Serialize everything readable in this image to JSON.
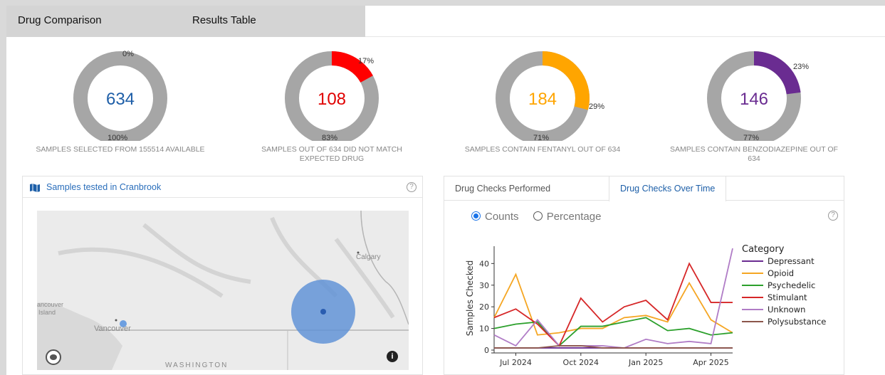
{
  "tabs": [
    {
      "label": "Drug Comparison"
    },
    {
      "label": "Results Table"
    }
  ],
  "donuts": [
    {
      "value": "634",
      "slice_percent": 0,
      "slice_label": "0%",
      "rest_label": "100%",
      "color": "#1f5fa8",
      "caption": "SAMPLES SELECTED FROM 155514 AVAILABLE"
    },
    {
      "value": "108",
      "slice_percent": 17,
      "slice_label": "17%",
      "rest_label": "83%",
      "color": "#ff0000",
      "caption": "SAMPLES OUT OF 634 DID NOT MATCH EXPECTED DRUG"
    },
    {
      "value": "184",
      "slice_percent": 29,
      "slice_label": "29%",
      "rest_label": "71%",
      "color": "#ffa500",
      "caption": "SAMPLES CONTAIN FENTANYL OUT OF 634"
    },
    {
      "value": "146",
      "slice_percent": 23,
      "slice_label": "23%",
      "rest_label": "77%",
      "color": "#6a2c91",
      "caption": "SAMPLES CONTAIN BENZODIAZEPINE OUT OF 634"
    }
  ],
  "map_panel": {
    "title": "Samples tested in Cranbrook",
    "help": "?",
    "labels": {
      "calgary": "Calgary",
      "vancouver": "Vancouver",
      "vancouver_island_1": "ancouver",
      "vancouver_island_2": "Island",
      "washington": "WASHINGTON"
    },
    "info": "i"
  },
  "chart_panel": {
    "tabs": [
      {
        "label": "Drug Checks Performed",
        "active": false
      },
      {
        "label": "Drug Checks Over Time",
        "active": true
      }
    ],
    "radio": {
      "counts": "Counts",
      "percentage": "Percentage",
      "selected": "counts"
    },
    "help": "?"
  },
  "chart_data": {
    "type": "line",
    "ylabel": "Samples Checked",
    "xlabel": "",
    "ylim": [
      0,
      48
    ],
    "yticks": [
      0,
      10,
      20,
      30,
      40
    ],
    "x": [
      "2024-06",
      "2024-07",
      "2024-08",
      "2024-09",
      "2024-10",
      "2024-11",
      "2024-12",
      "2025-01",
      "2025-02",
      "2025-03",
      "2025-04",
      "2025-05"
    ],
    "xticks": [
      {
        "label": "Jul 2024",
        "at": "2024-07"
      },
      {
        "label": "Oct 2024",
        "at": "2024-10"
      },
      {
        "label": "Jan 2025",
        "at": "2025-01"
      },
      {
        "label": "Apr 2025",
        "at": "2025-04"
      }
    ],
    "legend_title": "Category",
    "legend_position": "right",
    "series": [
      {
        "name": "Depressant",
        "color": "#6a2c91",
        "values": [
          1,
          1,
          1,
          1,
          1,
          1,
          1,
          1,
          1,
          1,
          1,
          1
        ]
      },
      {
        "name": "Opioid",
        "color": "#f5a623",
        "values": [
          15,
          35,
          7,
          8,
          10,
          10,
          15,
          16,
          13,
          31,
          14,
          8
        ]
      },
      {
        "name": "Psychedelic",
        "color": "#2ca02c",
        "values": [
          10,
          12,
          13,
          2,
          11,
          11,
          13,
          15,
          9,
          10,
          7,
          8
        ]
      },
      {
        "name": "Stimulant",
        "color": "#d62728",
        "values": [
          15,
          19,
          12,
          2,
          24,
          13,
          20,
          23,
          14,
          40,
          22,
          22
        ]
      },
      {
        "name": "Unknown",
        "color": "#b07cc6",
        "values": [
          7,
          2,
          14,
          2,
          2,
          2,
          1,
          5,
          3,
          4,
          3,
          47
        ]
      },
      {
        "name": "Polysubstance",
        "color": "#8c564b",
        "values": [
          1,
          1,
          1,
          2,
          2,
          1,
          1,
          1,
          1,
          1,
          1,
          1
        ]
      }
    ]
  }
}
